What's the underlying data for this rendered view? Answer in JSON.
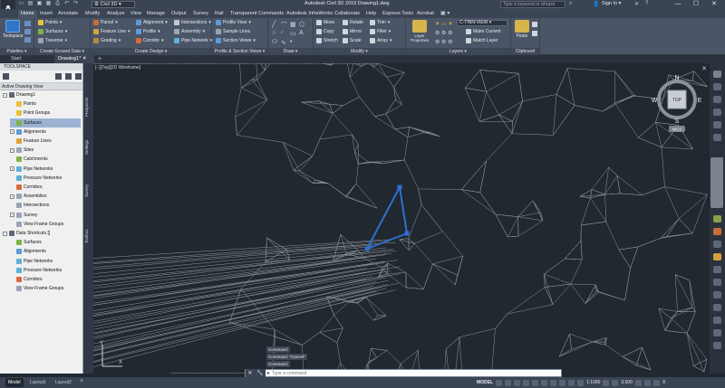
{
  "app": {
    "logo": "A",
    "workspace": "Civil 3D",
    "title": "Autodesk Civil 3D 2019    Drawing1.dwg",
    "search_placeholder": "Type a keyword or phrase",
    "signin": "Sign In",
    "win_min": "—",
    "win_max": "☐",
    "win_close": "✕"
  },
  "ribbon": {
    "tabs": [
      "Home",
      "Insert",
      "Annotate",
      "Modify",
      "Analyze",
      "View",
      "Manage",
      "Output",
      "Survey",
      "Rail",
      "Transparent Commands",
      "Autodesk InfraWorks",
      "Collaborate",
      "Help",
      "Express Tools",
      "Acrobat"
    ],
    "active_tab": "Home",
    "panels": {
      "palettes": "Palettes",
      "ground": "Create Ground Data",
      "design": "Create Design",
      "profile": "Profile & Section Views",
      "draw": "Draw",
      "modify": "Modify",
      "layers": "Layers",
      "clipboard": "Clipboard"
    },
    "buttons": {
      "toolspace": "Toolspace",
      "points": "Points",
      "surfaces": "Surfaces",
      "traverse": "Traverse",
      "parcel": "Parcel",
      "feature_line": "Feature Line",
      "grading": "Grading",
      "alignment": "Alignment",
      "profile": "Profile",
      "corridor": "Corridor",
      "intersections": "Intersections",
      "assembly": "Assembly",
      "pipe_network": "Pipe Network",
      "profile_view": "Profile View",
      "sample_lines": "Sample Lines",
      "section_views": "Section Views",
      "move": "Move",
      "copy": "Copy",
      "stretch": "Stretch",
      "rotate": "Rotate",
      "mirror": "Mirror",
      "scale": "Scale",
      "trim": "Trim",
      "fillet": "Fillet",
      "array": "Array",
      "layer_properties": "Layer Properties",
      "layer_combo": "C-TINN-VIEW",
      "make_current": "Make Current",
      "match_layer": "Match Layer",
      "paste": "Paste"
    }
  },
  "file_tabs": [
    "Start",
    "Drawing1*"
  ],
  "toolspace": {
    "title": "TOOLSPACE",
    "view": "Active Drawing View",
    "items": [
      {
        "label": "Drawing1",
        "tog": "−"
      },
      {
        "label": "Points",
        "tog": ""
      },
      {
        "label": "Point Groups",
        "tog": ""
      },
      {
        "label": "Surfaces",
        "tog": ""
      },
      {
        "label": "Alignments",
        "tog": "+"
      },
      {
        "label": "Feature Lines",
        "tog": ""
      },
      {
        "label": "Sites",
        "tog": "+"
      },
      {
        "label": "Catchments",
        "tog": ""
      },
      {
        "label": "Pipe Networks",
        "tog": "+"
      },
      {
        "label": "Pressure Networks",
        "tog": ""
      },
      {
        "label": "Corridors",
        "tog": ""
      },
      {
        "label": "Assemblies",
        "tog": "+"
      },
      {
        "label": "Intersections",
        "tog": ""
      },
      {
        "label": "Survey",
        "tog": "+"
      },
      {
        "label": "View Frame Groups",
        "tog": ""
      },
      {
        "label": "Data Shortcuts []",
        "tog": "−"
      },
      {
        "label": "Surfaces",
        "tog": ""
      },
      {
        "label": "Alignments",
        "tog": ""
      },
      {
        "label": "Pipe Networks",
        "tog": ""
      },
      {
        "label": "Pressure Networks",
        "tog": ""
      },
      {
        "label": "Corridors",
        "tog": ""
      },
      {
        "label": "View Frame Groups",
        "tog": ""
      }
    ],
    "vtabs": [
      "Prospector",
      "Settings",
      "Survey",
      "Toolbox"
    ]
  },
  "viewport": {
    "label": "[−][Top][2D Wireframe]",
    "viewcube": {
      "n": "N",
      "s": "S",
      "e": "E",
      "w": "W",
      "top": "TOP",
      "wcs": "WCS"
    }
  },
  "command": {
    "history": [
      "Command:",
      "Command: *Cancel*",
      "Command:"
    ],
    "placeholder": "Type a command"
  },
  "status": {
    "layouts": [
      "Model",
      "Layout1",
      "Layout2"
    ],
    "model": "MODEL",
    "scale": "1:1000",
    "value": "3.500"
  },
  "colors": {
    "canvas": "#212830",
    "mesh": "#8f969e",
    "triangle": "#2f6fd1",
    "accent": "#2f76c9"
  }
}
